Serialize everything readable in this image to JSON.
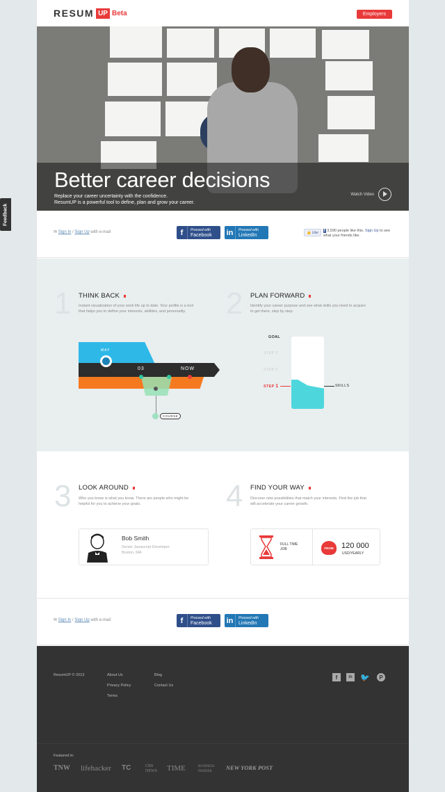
{
  "header": {
    "logo_text": "RESUM",
    "logo_up": "UP",
    "logo_beta": "Beta",
    "employers_label": "Employers"
  },
  "hero": {
    "title": "Better career decisions",
    "subtitle_line1": "Replace your career uncertainty with the confidence.",
    "subtitle_line2": "ResumUP is a powerful tool to define, plan and grow your career.",
    "watch_label": "Watch Video"
  },
  "signup": {
    "sign_in": "Sign In",
    "sep": " / ",
    "sign_up": "Sign Up",
    "with_email": " with e-mail",
    "facebook_small": "Proceed with",
    "facebook_label": "Facebook",
    "linkedin_small": "Proceed with",
    "linkedin_label": "LinkedIn",
    "like_label": "Like",
    "like_count_text": "3,590 people like this.",
    "like_signup": "Sign Up",
    "like_tail": "to see what your friends like."
  },
  "features": [
    {
      "num": "1",
      "title": "THINK BACK",
      "desc": "Instant visualization of your work life up to date. Your profile is a tool that helps you to define your interests, abilities, and personality."
    },
    {
      "num": "2",
      "title": "PLAN FORWARD",
      "desc": "Identify your career purpose and see what skills you need to acquire to get there, step by step."
    },
    {
      "num": "3",
      "title": "LOOK AROUND",
      "desc": "Who you know is what you know. There are people who might be helpful for you to achieve your goals."
    },
    {
      "num": "4",
      "title": "FIND YOUR WAY",
      "desc": "Discover new possibilities that match your interests. Find the job that will accelerate your career growth."
    }
  ],
  "timeline": {
    "may": "MAY",
    "month": "03",
    "now": "NOW",
    "course": "COURSE"
  },
  "plan": {
    "goal": "GOAL",
    "step3": "STEP 3",
    "step2": "STEP 2",
    "step1_label": "STEP",
    "step1_num": "1",
    "skills": "SKILLS"
  },
  "person_card": {
    "name": "Bob Smith",
    "role": "Senior Javascript Developer",
    "location": "Boston, MA"
  },
  "job_card": {
    "type_line1": "FULL TIME",
    "type_line2": "JOB",
    "from_label": "FROM",
    "salary": "120 000",
    "salary_unit": "USD/YEARLY"
  },
  "footer": {
    "copyright": "ResumUP © 2013",
    "links_col1": [
      "About Us",
      "Privacy Policy",
      "Terms"
    ],
    "links_col2": [
      "Blog",
      "Contact Us"
    ],
    "featured_label": "Featured in:",
    "press": [
      "TNW",
      "lifehacker",
      "TC",
      "CBS NEWS",
      "TIME",
      "BUSINESS INSIDER",
      "NEW YORK POST"
    ]
  },
  "feedback_label": "Feedback",
  "colors": {
    "accent": "#e93a3a",
    "facebook": "#2f4f8a",
    "linkedin": "#2277b5",
    "timeline_blue": "#2eb8e8",
    "timeline_orange": "#f57a1f",
    "skills_fill": "#4dd7dd",
    "footer_bg": "#333333"
  }
}
